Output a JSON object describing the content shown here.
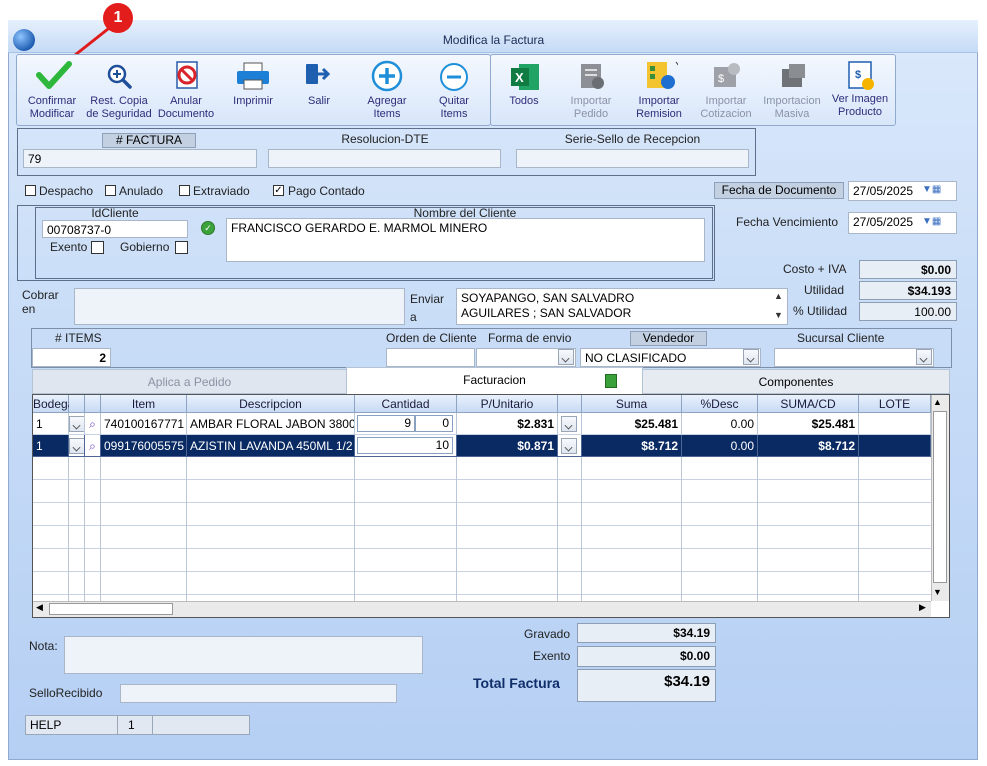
{
  "window": {
    "title": "Modifica la Factura"
  },
  "annotation": {
    "badge": "1"
  },
  "toolbar": {
    "confirm": "Confirmar\nModificar",
    "copy": "Rest. Copia\nde Seguridad",
    "cancel_doc": "Anular\nDocumento",
    "print": "Imprimir",
    "exit": "Salir",
    "add_items": "Agregar\nItems",
    "remove_items": "Quitar\nItems",
    "all": "Todos",
    "import_order": "Importar\nPedido",
    "import_remision": "Importar\nRemision",
    "import_quote": "Importar\nCotizacion",
    "mass_import": "Importacion\nMasiva",
    "view_image": "Ver Imagen\nProducto"
  },
  "invoice": {
    "number_label": "# FACTURA",
    "number": "79",
    "resolution_label": "Resolucion-DTE",
    "resolution": "",
    "seal_label": "Serie-Sello de Recepcion",
    "seal": ""
  },
  "flags": {
    "dispatch": "Despacho",
    "cancelled": "Anulado",
    "lost": "Extraviado",
    "cash": "Pago Contado",
    "cash_checked": true
  },
  "dates": {
    "doc_label": "Fecha de  Documento",
    "doc_date": "27/05/2025",
    "due_label": "Fecha Vencimiento",
    "due_date": "27/05/2025"
  },
  "customer": {
    "id_label": "IdCliente",
    "id": "00708737-0",
    "name_label": "Nombre del Cliente",
    "name": "FRANCISCO GERARDO E. MARMOL MINERO",
    "exempt_label": "Exento",
    "gov_label": "Gobierno"
  },
  "costs": {
    "cost_label": "Costo + IVA",
    "cost": "$0.00",
    "profit_label": "Utilidad",
    "profit": "$34.193",
    "pct_label": "% Utilidad",
    "pct": "100.00"
  },
  "address": {
    "collect_label": "Cobrar\nen",
    "collect": "",
    "send_label": "Enviar\na",
    "send_line1": "SOYAPANGO, SAN SALVADRO",
    "send_line2": "AGUILARES ; SAN SALVADOR"
  },
  "meta": {
    "items_label": "# ITEMS",
    "items_count": "2",
    "order_label": "Orden de Cliente",
    "ship_label": "Forma de envio",
    "seller_label": "Vendedor",
    "seller": "NO CLASIFICADO",
    "branch_label": "Sucursal Cliente"
  },
  "tabs": {
    "applied": "Aplica a Pedido",
    "billing": "Facturacion",
    "components": "Componentes"
  },
  "grid": {
    "headers": [
      "Bodega",
      "Item",
      "Descripcion",
      "Cantidad",
      "P/Unitario",
      "Suma",
      "%Desc",
      "SUMA/CD",
      "LOTE"
    ],
    "rows": [
      {
        "bodega": "1",
        "item": "740100167771",
        "desc": "AMBAR FLORAL JABON 3800",
        "qty": "9",
        "qty2": "0",
        "price": "$2.831",
        "sum": "$25.481",
        "disc": "0.00",
        "sumcd": "$25.481",
        "lote": ""
      },
      {
        "bodega": "1",
        "item": "099176005575",
        "desc": "AZISTIN LAVANDA 450ML 1/2",
        "qty": "10",
        "qty2": "",
        "price": "$0.871",
        "sum": "$8.712",
        "disc": "0.00",
        "sumcd": "$8.712",
        "lote": ""
      }
    ]
  },
  "totals": {
    "taxed_label": "Gravado",
    "taxed": "$34.19",
    "exempt_label": "Exento",
    "exempt": "$0.00",
    "total_label": "Total Factura",
    "total": "$34.19"
  },
  "notes": {
    "note_label": "Nota:",
    "seal_label": "SelloRecibido"
  },
  "status": {
    "help": "HELP",
    "page": "1",
    "extra": ""
  }
}
